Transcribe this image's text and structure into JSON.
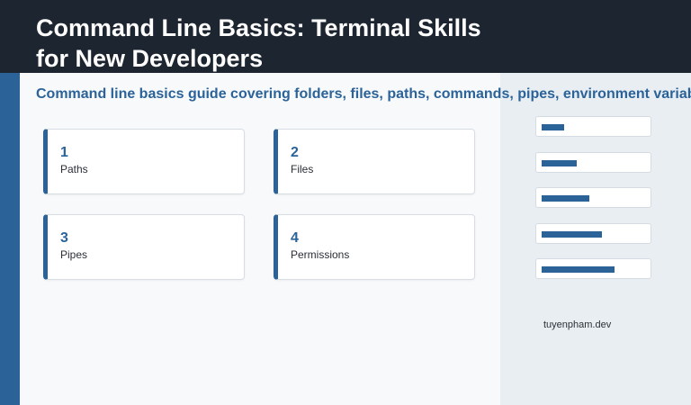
{
  "title": "Command Line Basics: Terminal Skills for New Developers",
  "subtitle": "Command line basics guide covering folders, files, paths, commands, pipes, environment variables, permissions, and terminal workflows",
  "cards": [
    {
      "number": "1",
      "label": "Paths"
    },
    {
      "number": "2",
      "label": "Files"
    },
    {
      "number": "3",
      "label": "Pipes"
    },
    {
      "number": "4",
      "label": "Permissions"
    }
  ],
  "progress_bars": [
    {
      "level": 0.22
    },
    {
      "level": 0.34
    },
    {
      "level": 0.46
    },
    {
      "level": 0.58
    },
    {
      "level": 0.7
    }
  ],
  "credit": "tuyenpham.dev",
  "colors": {
    "accent": "#2b6399",
    "header_bg": "#1c2530",
    "panel_bg": "#e9eef3",
    "page_bg": "#f7f9fb"
  }
}
